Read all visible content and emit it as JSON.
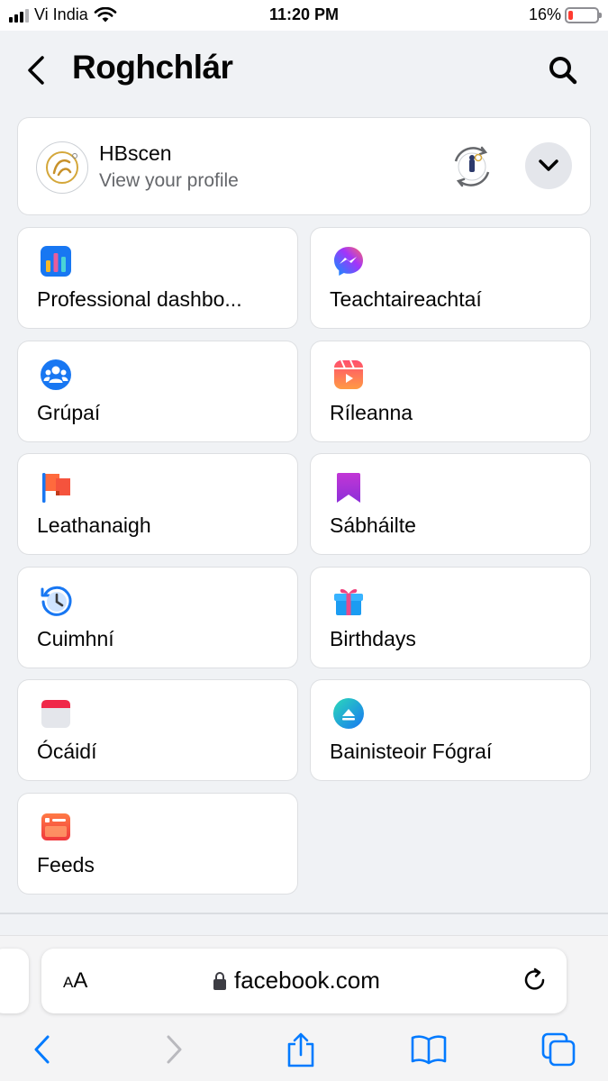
{
  "status_bar": {
    "carrier": "Vi India",
    "time": "11:20 PM",
    "battery_percent": "16%",
    "battery_level": 0.16
  },
  "header": {
    "title": "Roghchlár",
    "back_icon": "chevron-left-icon",
    "search_icon": "search-icon"
  },
  "profile": {
    "name": "HBscen",
    "subtitle": "View your profile"
  },
  "shortcuts": [
    {
      "label": "Professional dashbo...",
      "icon": "dashboard-icon"
    },
    {
      "label": "Teachtaireachtaí",
      "icon": "messenger-icon"
    },
    {
      "label": "Grúpaí",
      "icon": "groups-icon"
    },
    {
      "label": "Ríleanna",
      "icon": "reels-icon"
    },
    {
      "label": "Leathanaigh",
      "icon": "pages-flag-icon"
    },
    {
      "label": "Sábháilte",
      "icon": "saved-bookmark-icon"
    },
    {
      "label": "Cuimhní",
      "icon": "memories-clock-icon"
    },
    {
      "label": "Birthdays",
      "icon": "birthday-gift-icon"
    },
    {
      "label": "Ócáidí",
      "icon": "events-calendar-icon"
    },
    {
      "label": "Bainisteoir Fógraí",
      "icon": "ads-manager-icon"
    },
    {
      "label": "Feeds",
      "icon": "feeds-icon"
    }
  ],
  "browser": {
    "text_size_label_small": "A",
    "text_size_label_large": "A",
    "url": "facebook.com"
  },
  "colors": {
    "facebook_blue": "#1877f2",
    "background": "#f0f2f5",
    "safari_blue": "#007aff"
  }
}
